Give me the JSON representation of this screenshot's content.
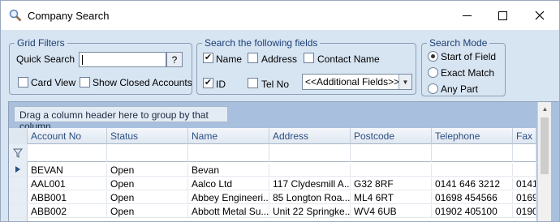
{
  "window": {
    "title": "Company Search"
  },
  "grid_filters": {
    "legend": "Grid Filters",
    "quick_search_label": "Quick Search",
    "quick_search_value": "",
    "quick_search_button": "?",
    "card_view_label": "Card View",
    "card_view_checked": false,
    "show_closed_label": "Show Closed Accounts",
    "show_closed_checked": false
  },
  "search_fields": {
    "legend": "Search the following fields",
    "name_label": "Name",
    "name_checked": true,
    "address_label": "Address",
    "address_checked": false,
    "contact_name_label": "Contact Name",
    "contact_name_checked": false,
    "id_label": "ID",
    "id_checked": true,
    "tel_no_label": "Tel No",
    "tel_no_checked": false,
    "additional_fields": "<<Additional Fields>>"
  },
  "search_mode": {
    "legend": "Search Mode",
    "options": [
      "Start of Field",
      "Exact Match",
      "Any Part"
    ],
    "selected": "Start of Field"
  },
  "grid": {
    "group_panel_text": "Drag a column header here to group by that column.",
    "columns": [
      "Account No",
      "Status",
      "Name",
      "Address",
      "Postcode",
      "Telephone",
      "Fax"
    ],
    "rows": [
      [
        "BEVAN",
        "Open",
        "Bevan",
        "",
        "",
        "",
        ""
      ],
      [
        "AAL001",
        "Open",
        "Aalco Ltd",
        "117 Clydesmill A...",
        "G32 8RF",
        "0141 646 3212",
        "0141"
      ],
      [
        "ABB001",
        "Open",
        "Abbey Engineeri...",
        "85 Longton Roa...",
        "ML4 6RT",
        "01698 454566",
        "0169"
      ],
      [
        "ABB002",
        "Open",
        "Abbott Metal Su...",
        "Unit 22 Springke...",
        "WV4 6UB",
        "01902 405100",
        "0190"
      ]
    ]
  }
}
